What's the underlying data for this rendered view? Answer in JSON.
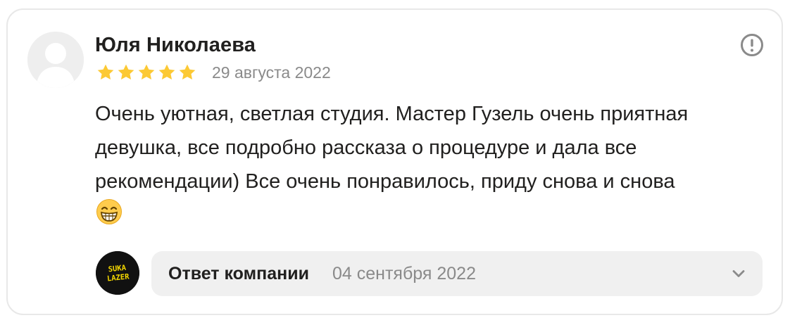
{
  "review": {
    "author": "Юля Николаева",
    "rating": 5,
    "rating_max": 5,
    "date": "29 августа 2022",
    "text": "Очень уютная, светлая студия. Мастер Гузель очень приятная девушка, все подробно рассказа о процедуре и дала все рекомендации) Все очень понравилось, приду снова и снова",
    "emoji": "grinning-face-with-smiling-eyes"
  },
  "company_reply": {
    "label": "Ответ компании",
    "date": "04 сентября 2022",
    "logo_text": [
      "SUKA",
      "LAZER"
    ]
  },
  "icons": {
    "report": "exclamation-circle-icon",
    "expand": "chevron-down-icon",
    "star": "star-icon"
  },
  "colors": {
    "star": "#fcc934",
    "text": "#21201f",
    "muted": "#8a8a8a",
    "reply_bg": "#f0f0f0",
    "logo_bg": "#111111",
    "logo_text": "#f5d800"
  }
}
